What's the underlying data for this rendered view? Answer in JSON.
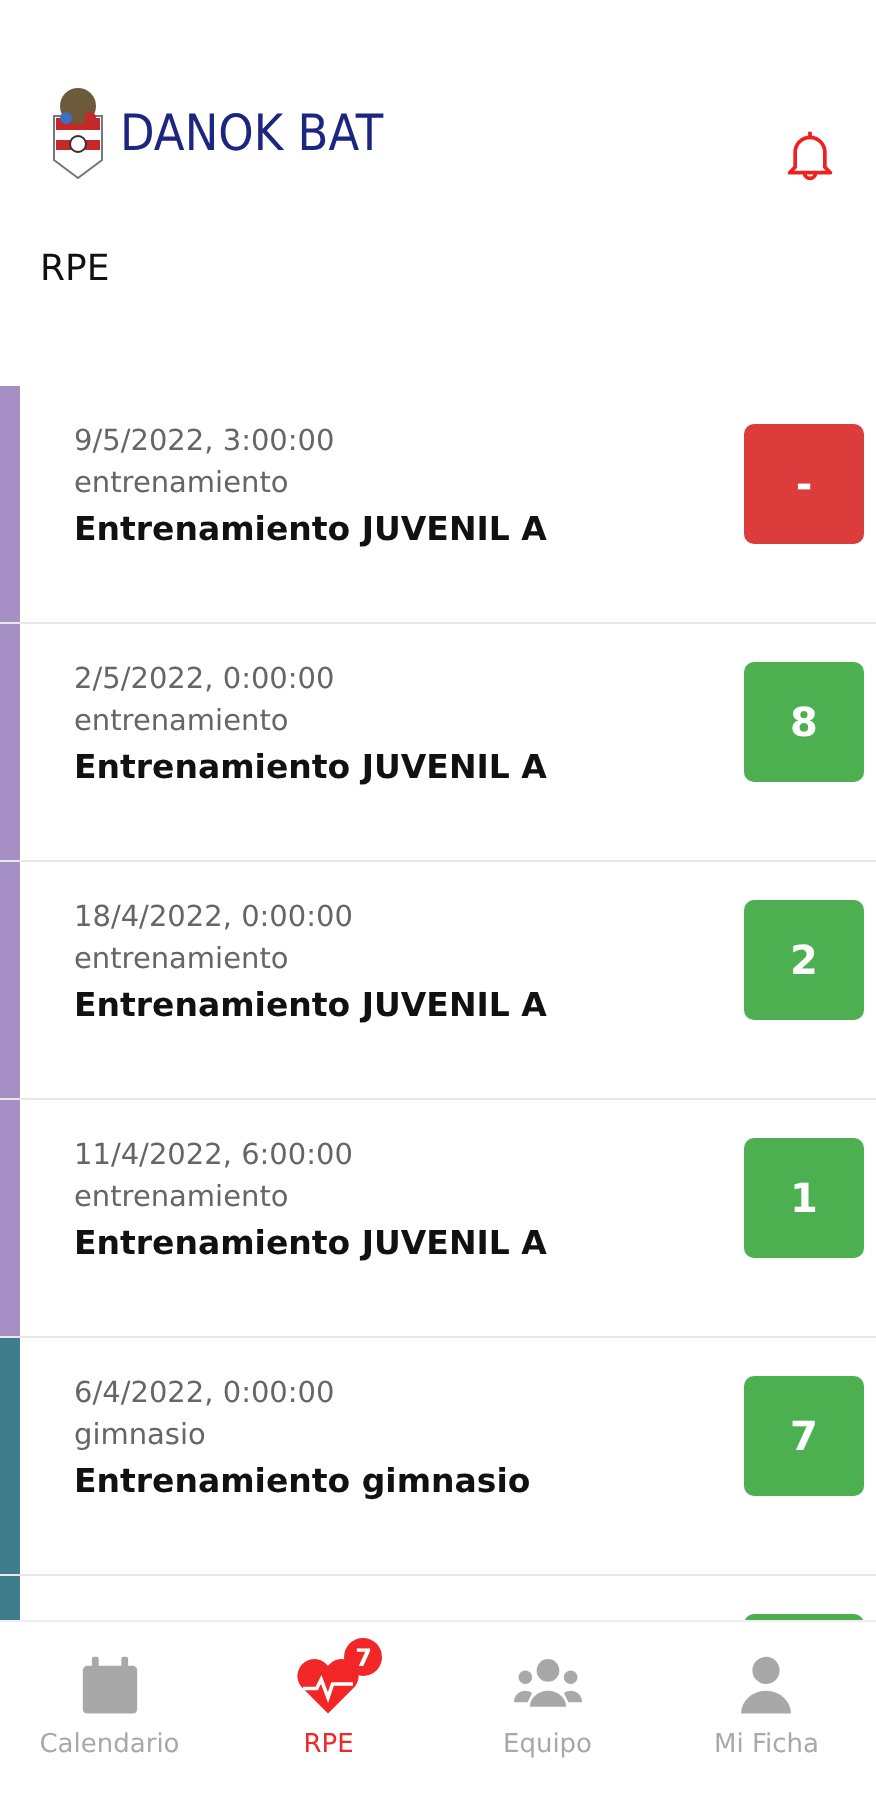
{
  "header": {
    "logo_text": "DANOK BAT"
  },
  "page_title": "RPE",
  "sessions": [
    {
      "date": "9/5/2022, 3:00:00",
      "type": "entrenamiento",
      "title": "Entrenamiento JUVENIL A",
      "color": "#a58fc4",
      "rpe": "-",
      "rated": false
    },
    {
      "date": "2/5/2022, 0:00:00",
      "type": "entrenamiento",
      "title": "Entrenamiento JUVENIL A",
      "color": "#a58fc4",
      "rpe": "8",
      "rated": true
    },
    {
      "date": "18/4/2022, 0:00:00",
      "type": "entrenamiento",
      "title": "Entrenamiento JUVENIL A",
      "color": "#a58fc4",
      "rpe": "2",
      "rated": true
    },
    {
      "date": "11/4/2022, 6:00:00",
      "type": "entrenamiento",
      "title": "Entrenamiento JUVENIL A",
      "color": "#a58fc4",
      "rpe": "1",
      "rated": true
    },
    {
      "date": "6/4/2022, 0:00:00",
      "type": "gimnasio",
      "title": "Entrenamiento gimnasio",
      "color": "#3f7c8c",
      "rpe": "7",
      "rated": true
    },
    {
      "color": "#3f7c8c",
      "rated": true
    }
  ],
  "nav": [
    {
      "kind": "calendar",
      "label": "Calendario",
      "selected": false
    },
    {
      "kind": "heart",
      "label": "RPE",
      "selected": true,
      "badge": "7"
    },
    {
      "kind": "group",
      "label": "Equipo",
      "selected": false
    },
    {
      "kind": "person",
      "label": "Mi Ficha",
      "selected": false
    }
  ]
}
